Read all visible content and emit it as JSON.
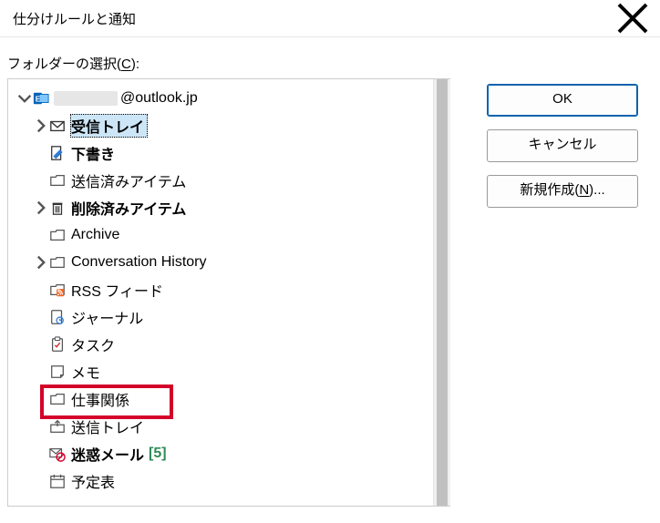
{
  "dialog": {
    "title": "仕分けルールと通知"
  },
  "subtitle": {
    "prefix": "フォルダーの選択(",
    "hotkey": "C",
    "suffix": "):"
  },
  "tree": {
    "root": {
      "account_suffix": "@outlook.jp"
    },
    "items": [
      {
        "label": "受信トレイ"
      },
      {
        "label": "下書き"
      },
      {
        "label": "送信済みアイテム"
      },
      {
        "label": "削除済みアイテム"
      },
      {
        "label": "Archive"
      },
      {
        "label": "Conversation History"
      },
      {
        "label": "RSS フィード"
      },
      {
        "label": "ジャーナル"
      },
      {
        "label": "タスク"
      },
      {
        "label": "メモ"
      },
      {
        "label": "仕事関係"
      },
      {
        "label": "送信トレイ"
      },
      {
        "label": "迷惑メール",
        "count": "[5]"
      },
      {
        "label": "予定表"
      }
    ]
  },
  "buttons": {
    "ok": "OK",
    "cancel": "キャンセル",
    "new_prefix": "新規作成(",
    "new_hotkey": "N",
    "new_suffix": ")..."
  }
}
